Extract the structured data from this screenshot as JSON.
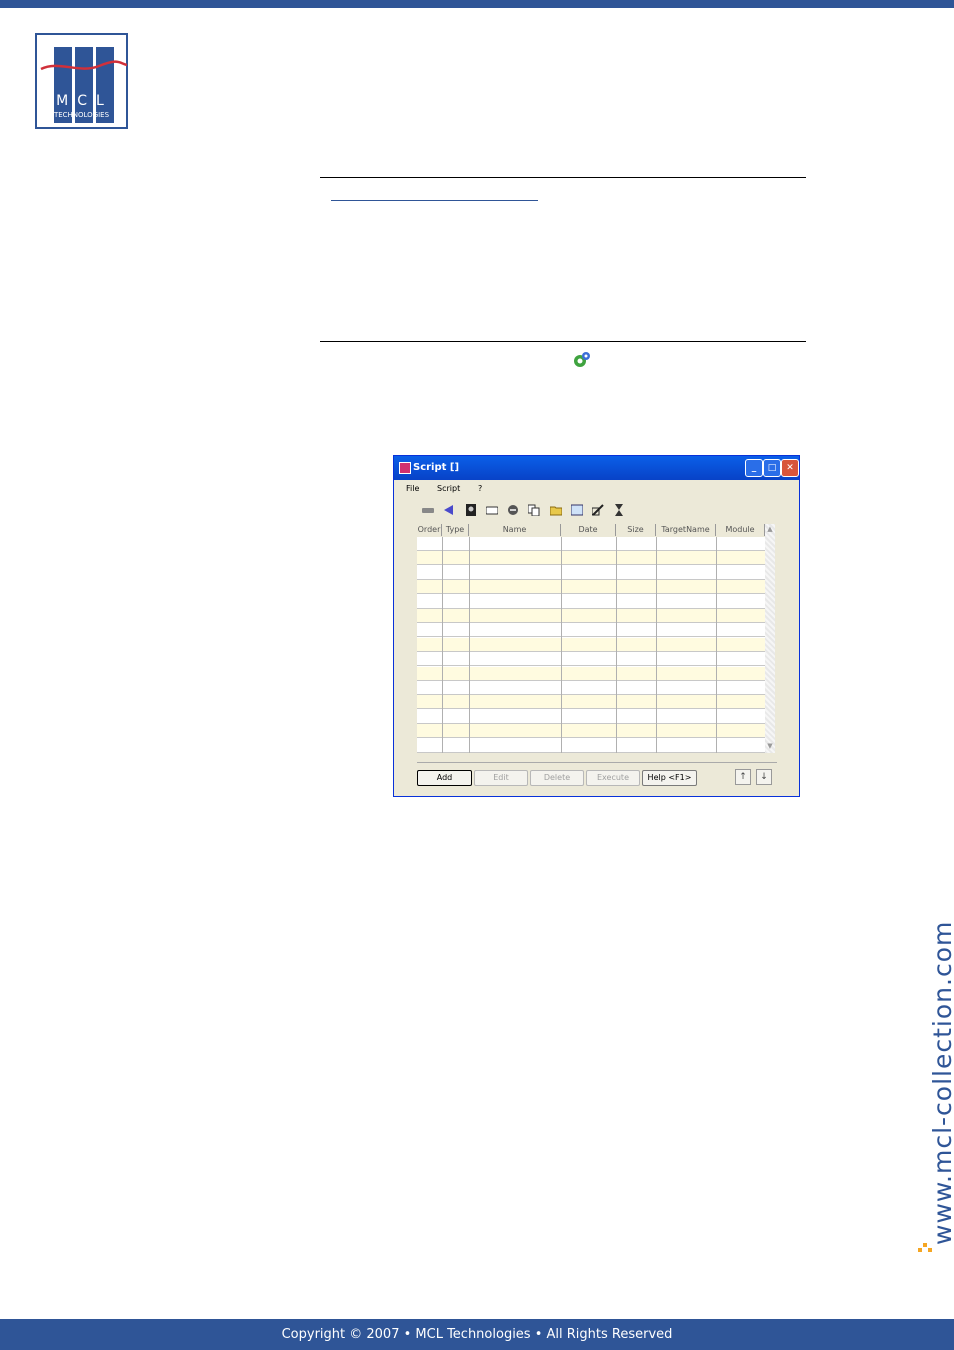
{
  "logo": {
    "letters": "MCL",
    "subtitle": "TECHNOLOGIES"
  },
  "footer": {
    "text": "Copyright © 2007 • MCL Technologies • All Rights Reserved"
  },
  "side_url": "www.mcl-collection.com",
  "window": {
    "title": "Script []",
    "menu": [
      "File",
      "Script",
      "?"
    ],
    "toolbar_icons": [
      "tape-icon",
      "arrow-icon",
      "book-icon",
      "card-icon",
      "transfer-icon",
      "copy-icon",
      "folder-icon",
      "image-icon",
      "edit-icon",
      "hourglass-icon"
    ],
    "columns": [
      "Order",
      "Type",
      "Name",
      "Date",
      "Size",
      "TargetName",
      "Module"
    ],
    "buttons": {
      "add": "Add",
      "edit": "Edit",
      "delete": "Delete",
      "execute": "Execute",
      "help": "Help <F1>"
    },
    "arrows": {
      "up": "↑",
      "down": "↓"
    }
  }
}
